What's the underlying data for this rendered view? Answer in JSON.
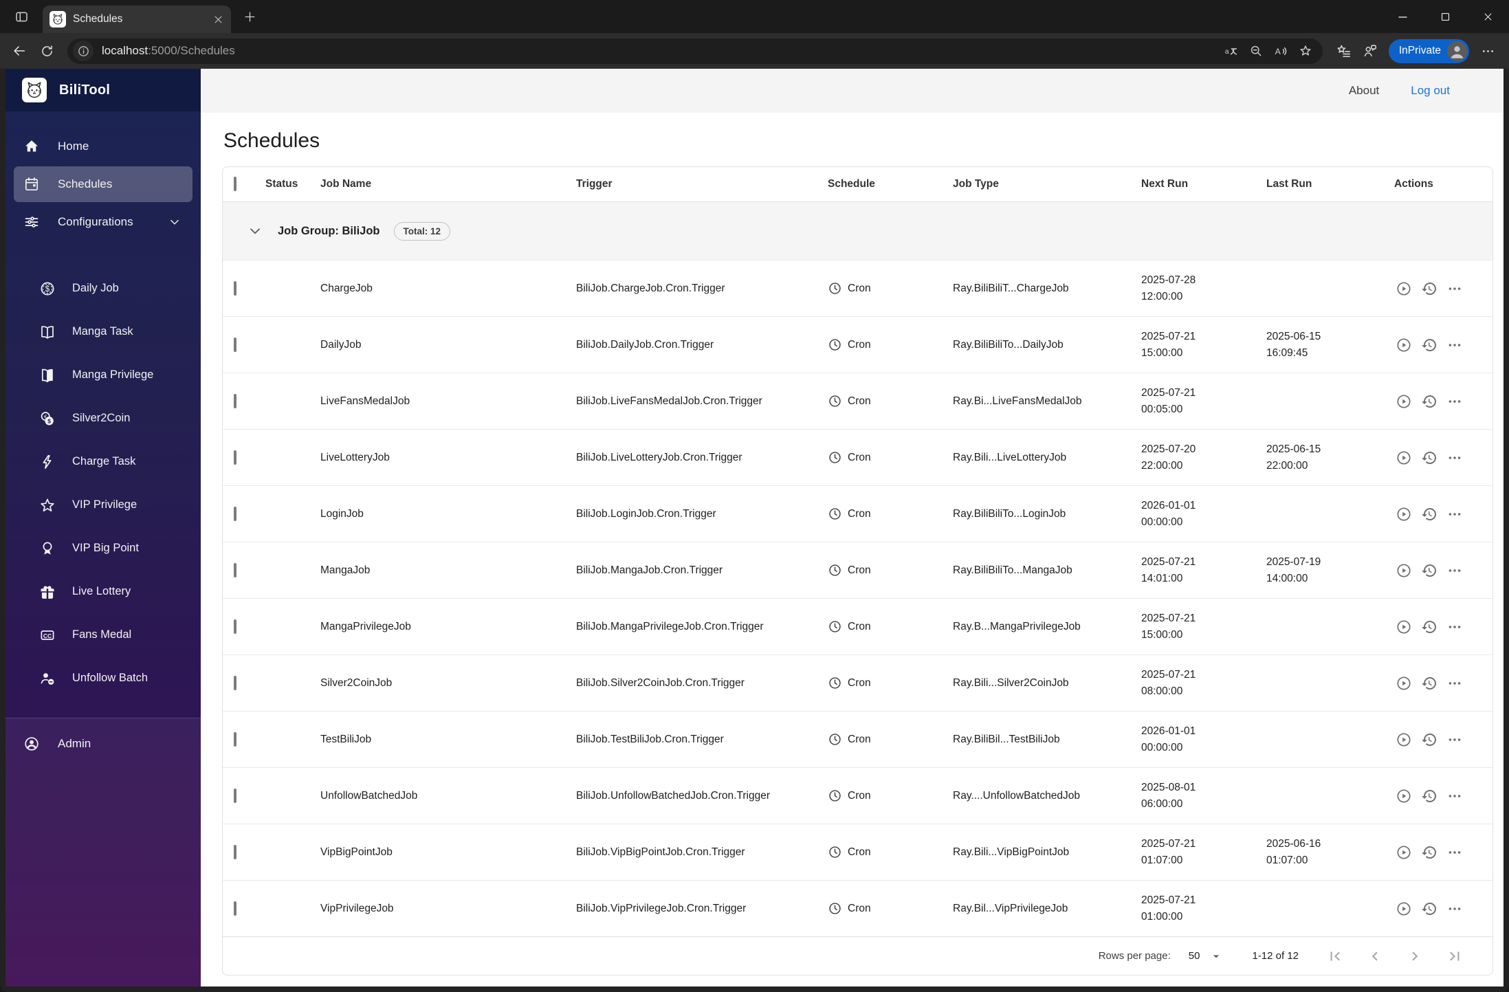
{
  "colors": {
    "status_green": "#4caf50",
    "link_blue": "#1976d2",
    "inprivate_blue": "#0d62c9",
    "sidebar_gradient_top": "#1b2452",
    "sidebar_gradient_bottom": "#3d0c52"
  },
  "browser": {
    "tab_title": "Schedules",
    "favicon": "cat-logo-icon",
    "url_host": "localhost",
    "url_path": ":5000/Schedules",
    "inprivate_label": "InPrivate"
  },
  "sidebar": {
    "brand": "BiliTool",
    "main_items": [
      {
        "label": "Home",
        "icon": "home-icon",
        "selected": false
      },
      {
        "label": "Schedules",
        "icon": "calendar-icon",
        "selected": true
      },
      {
        "label": "Configurations",
        "icon": "sliders-icon",
        "selected": false,
        "trailing_icon": "chevron-down-icon"
      }
    ],
    "sub_items": [
      {
        "label": "Daily Job",
        "icon": "dollar-coin-icon"
      },
      {
        "label": "Manga Task",
        "icon": "book-open-icon"
      },
      {
        "label": "Manga Privilege",
        "icon": "book-filled-icon"
      },
      {
        "label": "Silver2Coin",
        "icon": "coins-icon"
      },
      {
        "label": "Charge Task",
        "icon": "lightning-icon"
      },
      {
        "label": "VIP Privilege",
        "icon": "star-outline-icon"
      },
      {
        "label": "VIP Big Point",
        "icon": "medal-icon"
      },
      {
        "label": "Live Lottery",
        "icon": "gift-icon"
      },
      {
        "label": "Fans Medal",
        "icon": "cc-badge-icon"
      },
      {
        "label": "Unfollow Batch",
        "icon": "person-remove-icon"
      }
    ],
    "admin_item": {
      "label": "Admin",
      "icon": "account-circle-icon"
    }
  },
  "appbar": {
    "about": "About",
    "logout": "Log out"
  },
  "page": {
    "title": "Schedules"
  },
  "table": {
    "headers": [
      "Status",
      "Job Name",
      "Trigger",
      "Schedule",
      "Job Type",
      "Next Run",
      "Last Run",
      "Actions"
    ],
    "group": {
      "label": "Job Group: BiliJob",
      "badge": "Total: 12"
    },
    "rows": [
      {
        "name": "ChargeJob",
        "trigger": "BiliJob.ChargeJob.Cron.Trigger",
        "schedule": "Cron",
        "job_type": "Ray.BiliBiliT...ChargeJob",
        "next_run": {
          "date": "2025-07-28",
          "time": "12:00:00"
        },
        "last_run": null
      },
      {
        "name": "DailyJob",
        "trigger": "BiliJob.DailyJob.Cron.Trigger",
        "schedule": "Cron",
        "job_type": "Ray.BiliBiliTo...DailyJob",
        "next_run": {
          "date": "2025-07-21",
          "time": "15:00:00"
        },
        "last_run": {
          "date": "2025-06-15",
          "time": "16:09:45"
        }
      },
      {
        "name": "LiveFansMedalJob",
        "trigger": "BiliJob.LiveFansMedalJob.Cron.Trigger",
        "schedule": "Cron",
        "job_type": "Ray.Bi...LiveFansMedalJob",
        "next_run": {
          "date": "2025-07-21",
          "time": "00:05:00"
        },
        "last_run": null
      },
      {
        "name": "LiveLotteryJob",
        "trigger": "BiliJob.LiveLotteryJob.Cron.Trigger",
        "schedule": "Cron",
        "job_type": "Ray.Bili...LiveLotteryJob",
        "next_run": {
          "date": "2025-07-20",
          "time": "22:00:00"
        },
        "last_run": {
          "date": "2025-06-15",
          "time": "22:00:00"
        }
      },
      {
        "name": "LoginJob",
        "trigger": "BiliJob.LoginJob.Cron.Trigger",
        "schedule": "Cron",
        "job_type": "Ray.BiliBiliTo...LoginJob",
        "next_run": {
          "date": "2026-01-01",
          "time": "00:00:00"
        },
        "last_run": null
      },
      {
        "name": "MangaJob",
        "trigger": "BiliJob.MangaJob.Cron.Trigger",
        "schedule": "Cron",
        "job_type": "Ray.BiliBiliTo...MangaJob",
        "next_run": {
          "date": "2025-07-21",
          "time": "14:01:00"
        },
        "last_run": {
          "date": "2025-07-19",
          "time": "14:00:00"
        }
      },
      {
        "name": "MangaPrivilegeJob",
        "trigger": "BiliJob.MangaPrivilegeJob.Cron.Trigger",
        "schedule": "Cron",
        "job_type": "Ray.B...MangaPrivilegeJob",
        "next_run": {
          "date": "2025-07-21",
          "time": "15:00:00"
        },
        "last_run": null
      },
      {
        "name": "Silver2CoinJob",
        "trigger": "BiliJob.Silver2CoinJob.Cron.Trigger",
        "schedule": "Cron",
        "job_type": "Ray.Bili...Silver2CoinJob",
        "next_run": {
          "date": "2025-07-21",
          "time": "08:00:00"
        },
        "last_run": null
      },
      {
        "name": "TestBiliJob",
        "trigger": "BiliJob.TestBiliJob.Cron.Trigger",
        "schedule": "Cron",
        "job_type": "Ray.BiliBil...TestBiliJob",
        "next_run": {
          "date": "2026-01-01",
          "time": "00:00:00"
        },
        "last_run": null
      },
      {
        "name": "UnfollowBatchedJob",
        "trigger": "BiliJob.UnfollowBatchedJob.Cron.Trigger",
        "schedule": "Cron",
        "job_type": "Ray....UnfollowBatchedJob",
        "next_run": {
          "date": "2025-08-01",
          "time": "06:00:00"
        },
        "last_run": null
      },
      {
        "name": "VipBigPointJob",
        "trigger": "BiliJob.VipBigPointJob.Cron.Trigger",
        "schedule": "Cron",
        "job_type": "Ray.Bili...VipBigPointJob",
        "next_run": {
          "date": "2025-07-21",
          "time": "01:07:00"
        },
        "last_run": {
          "date": "2025-06-16",
          "time": "01:07:00"
        }
      },
      {
        "name": "VipPrivilegeJob",
        "trigger": "BiliJob.VipPrivilegeJob.Cron.Trigger",
        "schedule": "Cron",
        "job_type": "Ray.Bil...VipPrivilegeJob",
        "next_run": {
          "date": "2025-07-21",
          "time": "01:00:00"
        },
        "last_run": null
      }
    ]
  },
  "pagination": {
    "rows_per_page_label": "Rows per page:",
    "rows_per_page": "50",
    "range": "1-12 of 12"
  }
}
